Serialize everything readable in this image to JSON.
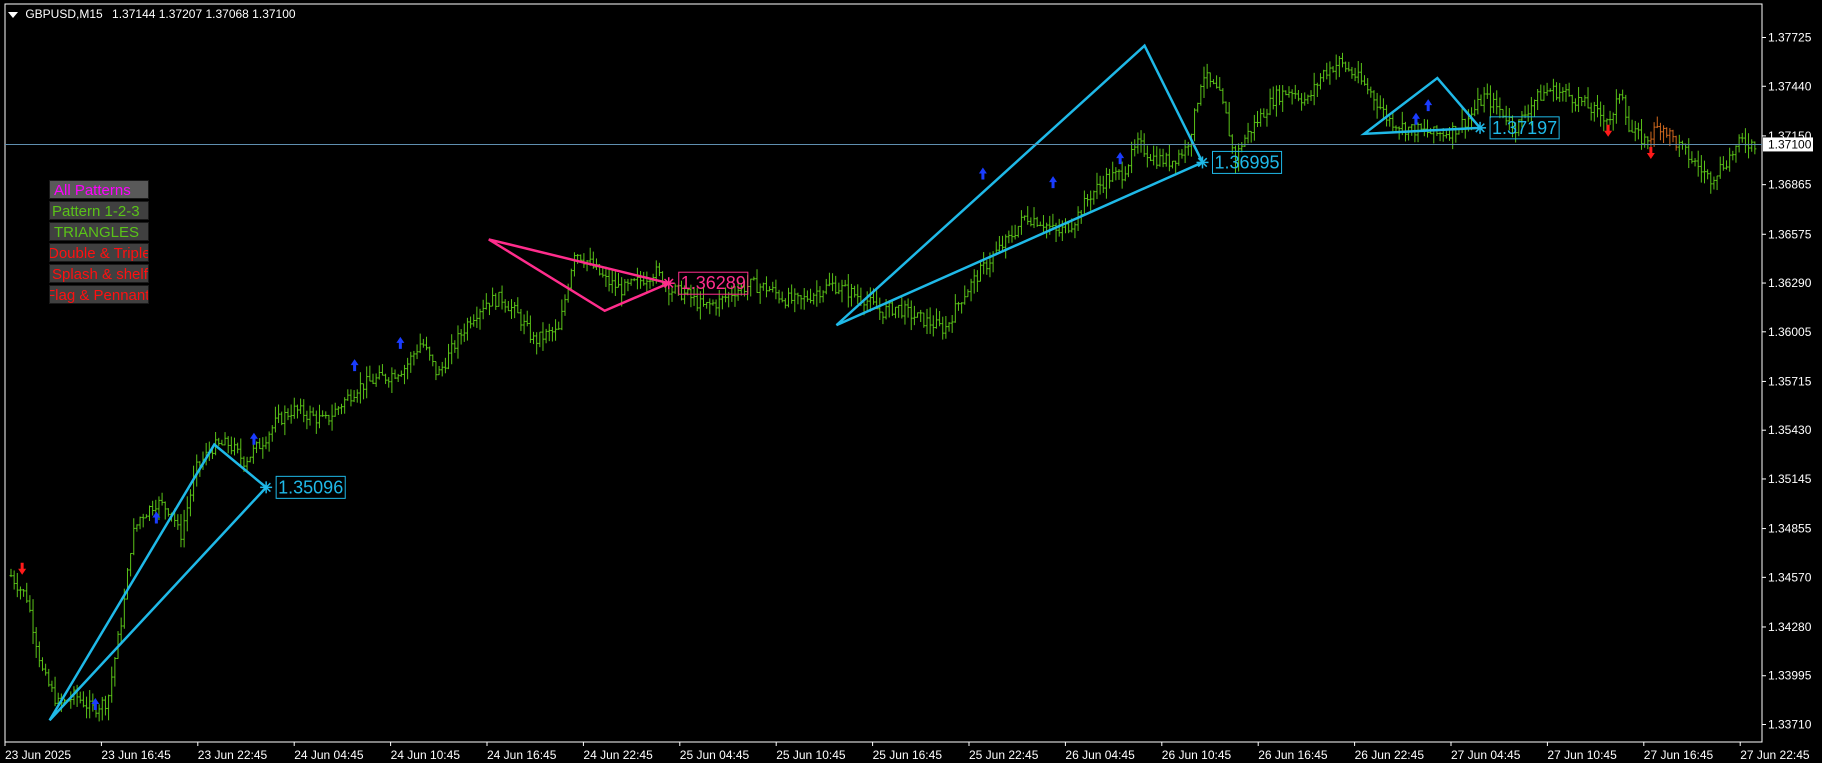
{
  "header": {
    "symbol": "GBPUSD,M15",
    "ohlc": "1.37144 1.37207 1.37068 1.37100"
  },
  "menu": {
    "items": [
      {
        "label": "All Patterns"
      },
      {
        "label": "Pattern 1-2-3"
      },
      {
        "label": "TRIANGLES"
      },
      {
        "label": "Double & Triple"
      },
      {
        "label": "Splash & shelf"
      },
      {
        "label": "Flag & Pennant"
      }
    ]
  },
  "colors": {
    "background": "#000000",
    "candles": "#5ac318",
    "candles_dark": "#3a8f10",
    "triangle": "#1fb9e8",
    "triangle_pink": "#ff2d8c",
    "arrow_up": "#1a3cff",
    "arrow_down": "#ff1a1a",
    "axis": "#ffffff",
    "current_price_line": "#5f8fb0"
  },
  "current_price": "1.37100",
  "chart_data": {
    "type": "candlestick",
    "price_axis": {
      "labels": [
        "1.37725",
        "1.37440",
        "1.37150",
        "1.36865",
        "1.36575",
        "1.36290",
        "1.36005",
        "1.35715",
        "1.35430",
        "1.35145",
        "1.34855",
        "1.34570",
        "1.34280",
        "1.33995",
        "1.33710"
      ],
      "range": [
        1.336,
        1.3785
      ]
    },
    "time_axis": {
      "labels": [
        "23 Jun 2025",
        "23 Jun 16:45",
        "23 Jun 22:45",
        "24 Jun 04:45",
        "24 Jun 10:45",
        "24 Jun 16:45",
        "24 Jun 22:45",
        "25 Jun 04:45",
        "25 Jun 10:45",
        "25 Jun 16:45",
        "25 Jun 22:45",
        "26 Jun 04:45",
        "26 Jun 10:45",
        "26 Jun 16:45",
        "26 Jun 22:45",
        "27 Jun 04:45",
        "27 Jun 10:45",
        "27 Jun 16:45",
        "27 Jun 22:45"
      ]
    },
    "bars_approx": 384,
    "price_path": [
      [
        0,
        1.3458
      ],
      [
        4,
        1.3445
      ],
      [
        8,
        1.34
      ],
      [
        12,
        1.3382
      ],
      [
        16,
        1.3388
      ],
      [
        20,
        1.338
      ],
      [
        24,
        1.3385
      ],
      [
        28,
        1.344
      ],
      [
        30,
        1.348
      ],
      [
        32,
        1.3492
      ],
      [
        36,
        1.3501
      ],
      [
        40,
        1.3496
      ],
      [
        42,
        1.348
      ],
      [
        46,
        1.352
      ],
      [
        50,
        1.3533
      ],
      [
        54,
        1.3535
      ],
      [
        58,
        1.3525
      ],
      [
        62,
        1.3535
      ],
      [
        66,
        1.3548
      ],
      [
        70,
        1.3555
      ],
      [
        74,
        1.3552
      ],
      [
        78,
        1.3548
      ],
      [
        82,
        1.3558
      ],
      [
        86,
        1.3568
      ],
      [
        90,
        1.3572
      ],
      [
        94,
        1.3575
      ],
      [
        98,
        1.358
      ],
      [
        102,
        1.3595
      ],
      [
        106,
        1.3575
      ],
      [
        110,
        1.3592
      ],
      [
        114,
        1.3608
      ],
      [
        118,
        1.3618
      ],
      [
        122,
        1.362
      ],
      [
        126,
        1.361
      ],
      [
        130,
        1.3595
      ],
      [
        134,
        1.36
      ],
      [
        136,
        1.36
      ],
      [
        140,
        1.3648
      ],
      [
        144,
        1.364
      ],
      [
        148,
        1.363
      ],
      [
        152,
        1.3625
      ],
      [
        156,
        1.363
      ],
      [
        160,
        1.3636
      ],
      [
        164,
        1.3625
      ],
      [
        168,
        1.3622
      ],
      [
        172,
        1.3615
      ],
      [
        176,
        1.3618
      ],
      [
        180,
        1.3625
      ],
      [
        184,
        1.3628
      ],
      [
        188,
        1.3626
      ],
      [
        192,
        1.362
      ],
      [
        196,
        1.3618
      ],
      [
        200,
        1.3624
      ],
      [
        204,
        1.3628
      ],
      [
        208,
        1.3624
      ],
      [
        212,
        1.362
      ],
      [
        216,
        1.3612
      ],
      [
        220,
        1.3615
      ],
      [
        224,
        1.361
      ],
      [
        228,
        1.3606
      ],
      [
        232,
        1.3602
      ],
      [
        236,
        1.362
      ],
      [
        240,
        1.3633
      ],
      [
        244,
        1.3645
      ],
      [
        248,
        1.3655
      ],
      [
        252,
        1.3668
      ],
      [
        256,
        1.3665
      ],
      [
        260,
        1.3658
      ],
      [
        264,
        1.3665
      ],
      [
        268,
        1.368
      ],
      [
        272,
        1.369
      ],
      [
        276,
        1.3693
      ],
      [
        280,
        1.371
      ],
      [
        284,
        1.3702
      ],
      [
        288,
        1.37
      ],
      [
        292,
        1.3708
      ],
      [
        294,
        1.3726
      ],
      [
        296,
        1.3752
      ],
      [
        298,
        1.3745
      ],
      [
        300,
        1.374
      ],
      [
        302,
        1.3725
      ],
      [
        304,
        1.37
      ],
      [
        306,
        1.3712
      ],
      [
        310,
        1.3725
      ],
      [
        314,
        1.3738
      ],
      [
        318,
        1.3742
      ],
      [
        322,
        1.3735
      ],
      [
        326,
        1.3752
      ],
      [
        330,
        1.3758
      ],
      [
        334,
        1.375
      ],
      [
        338,
        1.374
      ],
      [
        342,
        1.3725
      ],
      [
        346,
        1.372
      ],
      [
        350,
        1.3718
      ],
      [
        354,
        1.3716
      ],
      [
        358,
        1.3718
      ],
      [
        362,
        1.3725
      ],
      [
        366,
        1.3738
      ],
      [
        370,
        1.373
      ],
      [
        374,
        1.372
      ],
      [
        378,
        1.3735
      ],
      [
        382,
        1.3742
      ],
      [
        386,
        1.374
      ],
      [
        390,
        1.3735
      ],
      [
        394,
        1.3728
      ],
      [
        398,
        1.3725
      ],
      [
        400,
        1.3745
      ],
      [
        402,
        1.3718
      ],
      [
        406,
        1.3712
      ],
      [
        410,
        1.3722
      ],
      [
        414,
        1.371
      ],
      [
        418,
        1.37
      ],
      [
        422,
        1.369
      ],
      [
        426,
        1.37
      ],
      [
        430,
        1.3712
      ],
      [
        434,
        1.371
      ]
    ],
    "triangles": [
      {
        "points": [
          [
            1.33735,
            12
          ],
          [
            1.35346,
            66
          ],
          [
            1.35096,
            83
          ]
        ],
        "label": "1.35096",
        "color": "triangle"
      },
      {
        "points": [
          [
            1.36545,
            156
          ],
          [
            1.36128,
            194
          ],
          [
            1.36289,
            215
          ]
        ],
        "label": "1.36289",
        "color": "triangle_pink"
      },
      {
        "points": [
          [
            1.36044,
            270
          ],
          [
            1.37677,
            371
          ],
          [
            1.36995,
            390
          ]
        ],
        "label": "1.36995",
        "color": "triangle"
      },
      {
        "points": [
          [
            1.37162,
            443
          ],
          [
            1.37488,
            467
          ],
          [
            1.37197,
            481
          ]
        ],
        "label": "1.37197",
        "color": "triangle"
      }
    ],
    "up_arrows": [
      [
        1.3383,
        27
      ],
      [
        1.3492,
        47
      ],
      [
        1.3538,
        79
      ],
      [
        1.3594,
        127
      ],
      [
        1.3581,
        112
      ],
      [
        1.3688,
        341
      ],
      [
        1.3693,
        318
      ],
      [
        1.3702,
        363
      ],
      [
        1.3725,
        460
      ],
      [
        1.3733,
        464
      ]
    ],
    "down_arrows": [
      [
        1.3462,
        3
      ],
      [
        1.3718,
        523
      ],
      [
        1.3705,
        537
      ]
    ]
  }
}
